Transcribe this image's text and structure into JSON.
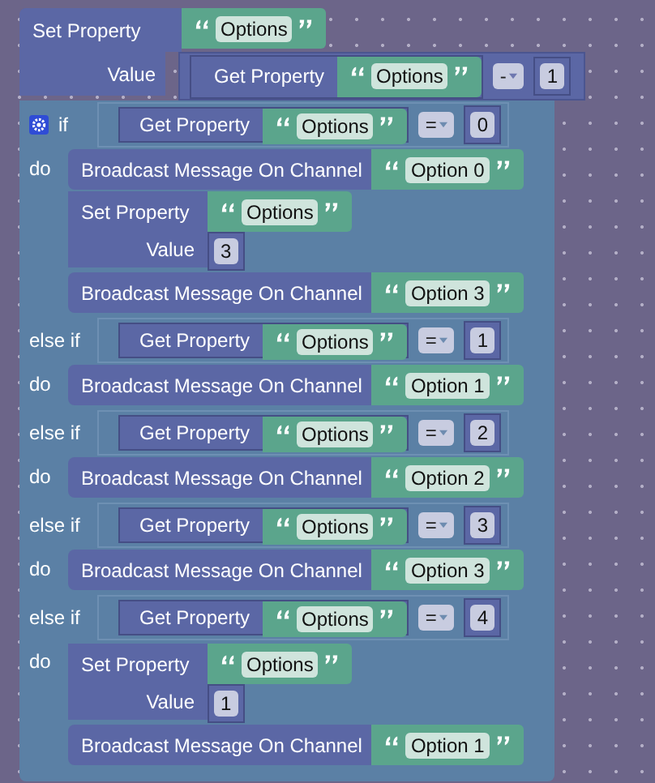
{
  "blocks": [
    {
      "kind": "set",
      "label": "Set Property",
      "property": "Options",
      "value_label": "Value",
      "value": {
        "kind": "math",
        "get_label": "Get Property",
        "property": "Options",
        "op": "-",
        "number": "1"
      }
    },
    {
      "kind": "if",
      "branches": [
        {
          "keyword": "if",
          "condition": {
            "get_label": "Get Property",
            "property": "Options",
            "op": "=",
            "number": "0"
          },
          "do_label": "do",
          "statements": [
            {
              "kind": "broadcast",
              "label": "Broadcast Message On Channel",
              "message": "Option 0"
            },
            {
              "kind": "set",
              "label": "Set Property",
              "property": "Options",
              "value_label": "Value",
              "value": {
                "kind": "number",
                "number": "3"
              }
            },
            {
              "kind": "broadcast",
              "label": "Broadcast Message On Channel",
              "message": "Option 3"
            }
          ]
        },
        {
          "keyword": "else if",
          "condition": {
            "get_label": "Get Property",
            "property": "Options",
            "op": "=",
            "number": "1"
          },
          "do_label": "do",
          "statements": [
            {
              "kind": "broadcast",
              "label": "Broadcast Message On Channel",
              "message": "Option 1"
            }
          ]
        },
        {
          "keyword": "else if",
          "condition": {
            "get_label": "Get Property",
            "property": "Options",
            "op": "=",
            "number": "2"
          },
          "do_label": "do",
          "statements": [
            {
              "kind": "broadcast",
              "label": "Broadcast Message On Channel",
              "message": "Option 2"
            }
          ]
        },
        {
          "keyword": "else if",
          "condition": {
            "get_label": "Get Property",
            "property": "Options",
            "op": "=",
            "number": "3"
          },
          "do_label": "do",
          "statements": [
            {
              "kind": "broadcast",
              "label": "Broadcast Message On Channel",
              "message": "Option 3"
            }
          ]
        },
        {
          "keyword": "else if",
          "condition": {
            "get_label": "Get Property",
            "property": "Options",
            "op": "=",
            "number": "4"
          },
          "do_label": "do",
          "statements": [
            {
              "kind": "set",
              "label": "Set Property",
              "property": "Options",
              "value_label": "Value",
              "value": {
                "kind": "number",
                "number": "1"
              }
            },
            {
              "kind": "broadcast",
              "label": "Broadcast Message On Channel",
              "message": "Option 1"
            }
          ]
        }
      ]
    }
  ]
}
